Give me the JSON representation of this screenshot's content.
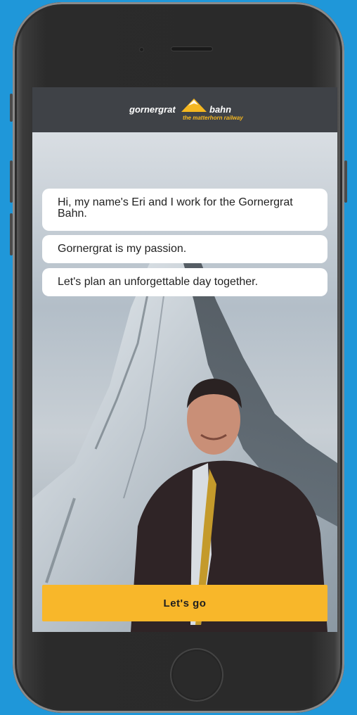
{
  "brand": {
    "word_left": "gornergrat",
    "word_right": "bahn",
    "tagline": "the matterhorn railway",
    "accent_color": "#f5b720"
  },
  "chat": {
    "messages": [
      "Hi, my name's Eri and I work for the Gornergrat Bahn.",
      "Gornergrat is my passion.",
      "Let's plan an unforgettable day together."
    ]
  },
  "cta": {
    "label": "Let's go",
    "color": "#f8b72a"
  },
  "device": {
    "background_color": "#1f97d9",
    "frame_color": "#2a2a2a"
  }
}
